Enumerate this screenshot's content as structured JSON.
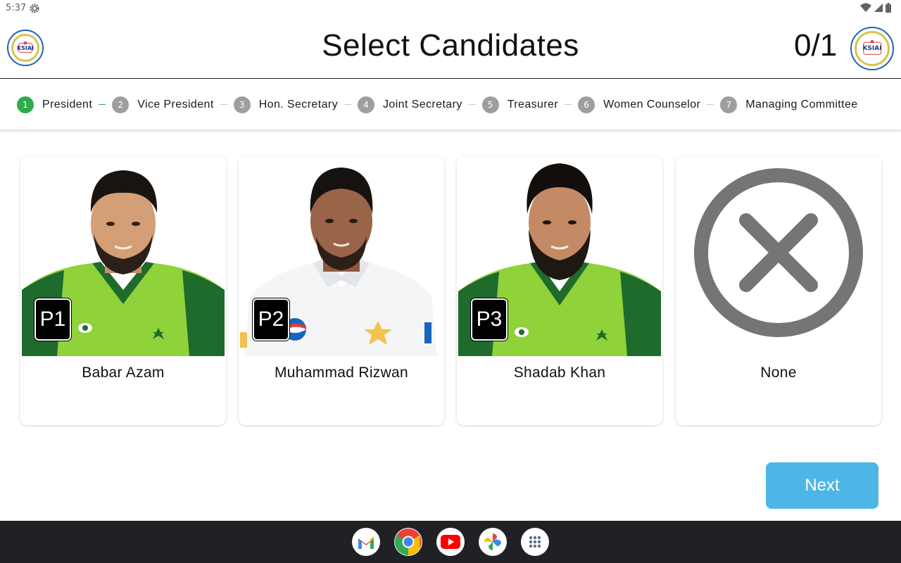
{
  "status": {
    "time": "5:37"
  },
  "header": {
    "title": "Select Candidates",
    "counter": "0/1",
    "logo_text": "KSIAI"
  },
  "stepper": {
    "steps": [
      {
        "num": "1",
        "label": "President"
      },
      {
        "num": "2",
        "label": "Vice President"
      },
      {
        "num": "3",
        "label": "Hon. Secretary"
      },
      {
        "num": "4",
        "label": "Joint Secretary"
      },
      {
        "num": "5",
        "label": "Treasurer"
      },
      {
        "num": "6",
        "label": "Women Counselor"
      },
      {
        "num": "7",
        "label": "Managing Committee"
      }
    ]
  },
  "candidates": [
    {
      "badge": "P1",
      "name": "Babar Azam"
    },
    {
      "badge": "P2",
      "name": "Muhammad Rizwan"
    },
    {
      "badge": "P3",
      "name": "Shadab Khan"
    },
    {
      "name": "None"
    }
  ],
  "actions": {
    "next_label": "Next"
  },
  "taskbar": {
    "apps": [
      "gmail-icon",
      "chrome-icon",
      "youtube-icon",
      "photos-icon",
      "app-drawer-icon"
    ]
  },
  "colors": {
    "active_step": "#2eab4a",
    "next_button": "#4db6e6",
    "jersey_green": "#8fd23a",
    "jersey_dark": "#1e6b2c"
  }
}
